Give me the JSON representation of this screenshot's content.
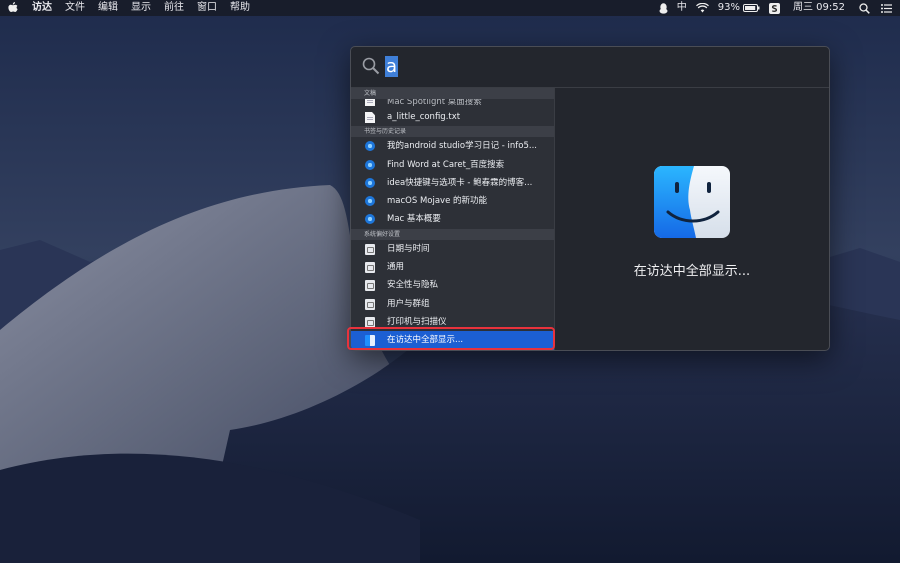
{
  "menubar": {
    "apple_icon": "apple-logo-icon",
    "app_name": "访达",
    "menus": [
      "文件",
      "编辑",
      "显示",
      "前往",
      "窗口",
      "帮助"
    ],
    "status": {
      "qq_icon": "qq-penguin-icon",
      "input_method": "中",
      "wifi_icon": "wifi-icon",
      "battery_percent": "93%",
      "battery_level": 0.93,
      "clipboard_app_icon": "s-app-icon",
      "datetime": "周三 09:52",
      "search_icon": "spotlight-search-icon",
      "control_icon": "list-menu-icon"
    }
  },
  "spotlight": {
    "query": "a",
    "sections": [
      {
        "header": "文稿",
        "items": [
          {
            "label": "Mac Spotlight 桌面搜索",
            "icon": "document-icon",
            "partial": true
          },
          {
            "label": "a_little_config.txt",
            "icon": "document-icon"
          }
        ]
      },
      {
        "header": "书签与历史记录",
        "items": [
          {
            "label": "我的android studio学习日记 - info5...",
            "icon": "safari-icon"
          },
          {
            "label": "Find Word at Caret_百度搜索",
            "icon": "safari-icon"
          },
          {
            "label": "idea快捷键与选项卡 - 鲍春霖的博客...",
            "icon": "safari-icon"
          },
          {
            "label": "macOS Mojave 的新功能",
            "icon": "safari-icon"
          },
          {
            "label": "Mac 基本概要",
            "icon": "safari-icon"
          }
        ]
      },
      {
        "header": "系统偏好设置",
        "items": [
          {
            "label": "日期与时间",
            "icon": "preference-icon"
          },
          {
            "label": "通用",
            "icon": "preference-icon"
          },
          {
            "label": "安全性与隐私",
            "icon": "preference-icon"
          },
          {
            "label": "用户与群组",
            "icon": "preference-icon"
          },
          {
            "label": "打印机与扫描仪",
            "icon": "preference-icon"
          }
        ]
      }
    ],
    "selected_item": {
      "label": "在访达中全部显示...",
      "icon": "finder-icon"
    },
    "preview": {
      "icon": "finder-icon",
      "caption": "在访达中全部显示..."
    }
  },
  "colors": {
    "selection": "#1c5fd3",
    "annotation_box": "#e8323c",
    "panel": "#23262d"
  }
}
